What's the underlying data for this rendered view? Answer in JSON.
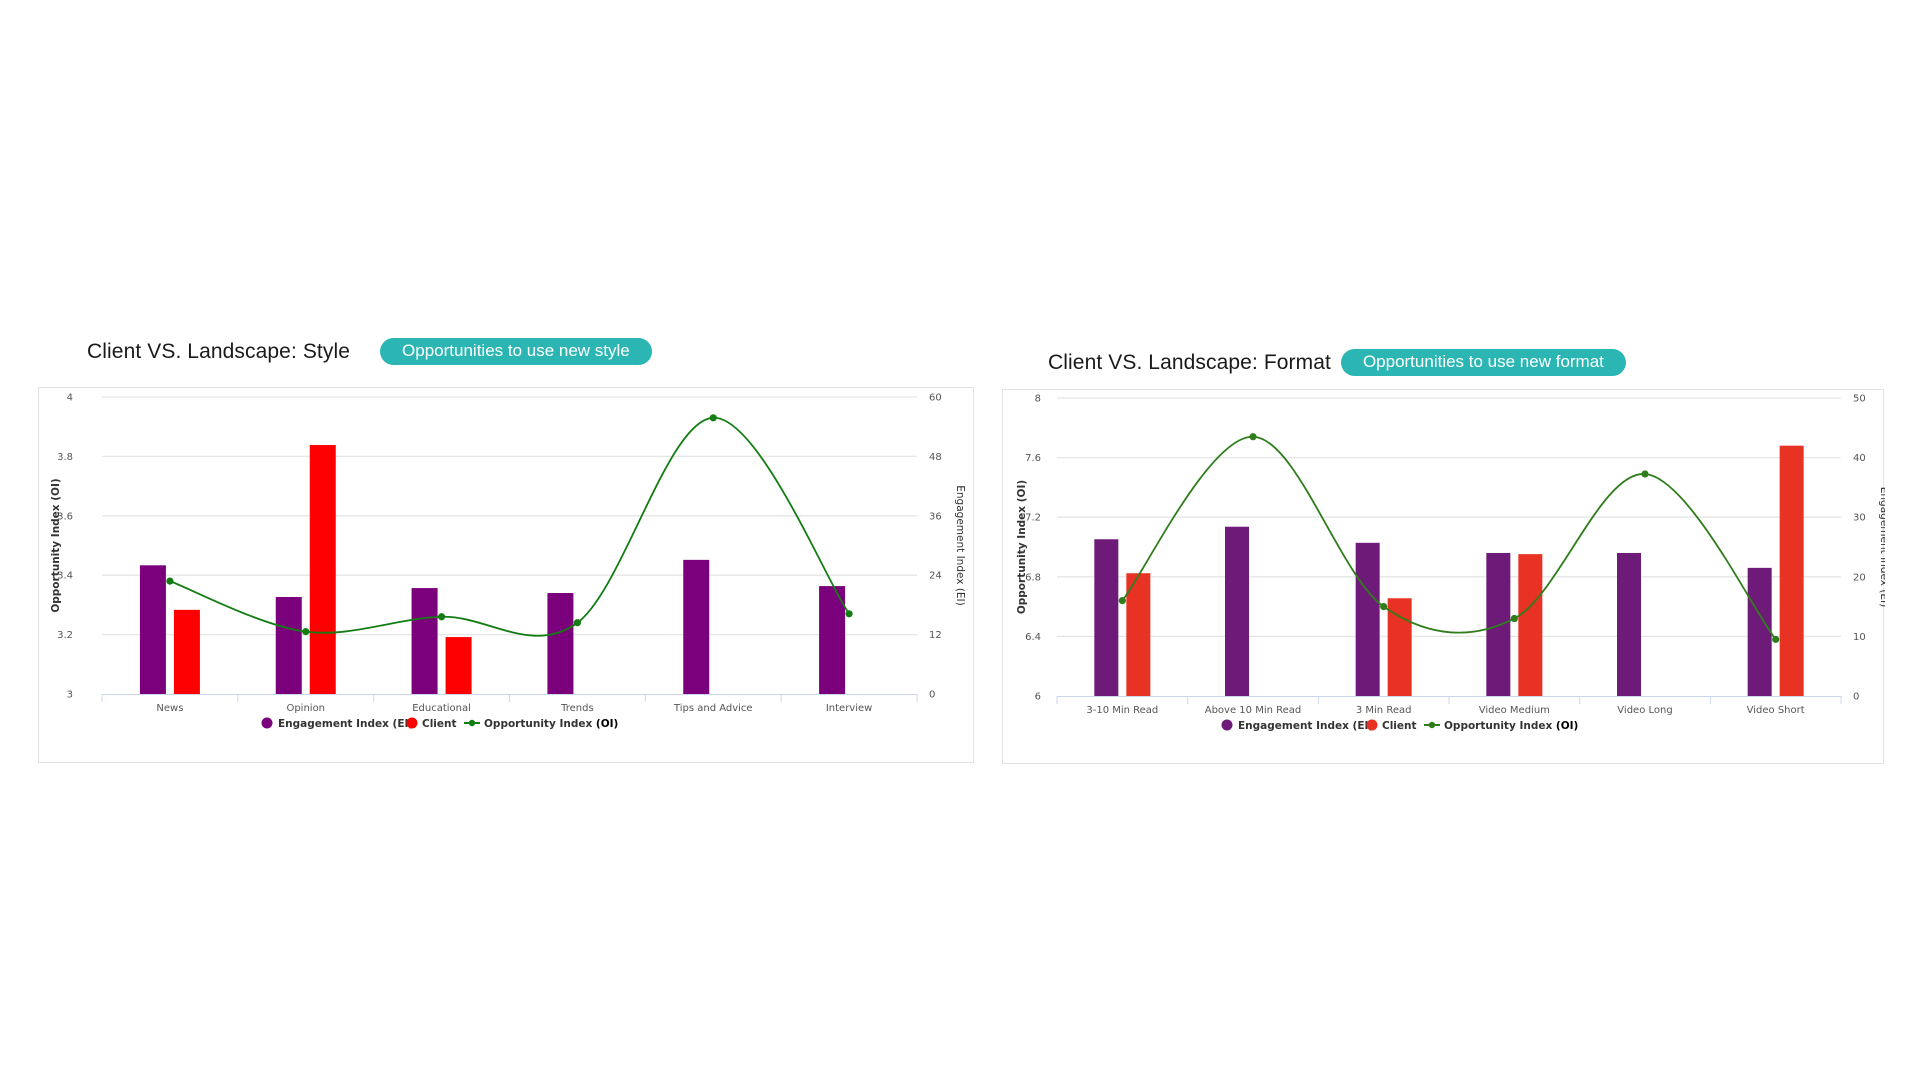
{
  "chart_data": [
    {
      "id": "style",
      "type": "bar",
      "title": "Client VS. Landscape: Style",
      "badge": "Opportunities to use new style",
      "categories": [
        "News",
        "Opinion",
        "Educational",
        "Trends",
        "Tips and Advice",
        "Interview"
      ],
      "series": [
        {
          "name": "Engagement Index (EI)",
          "type": "bar",
          "axis": "right",
          "color": "#7b007b",
          "values": [
            26,
            19.6,
            21.4,
            20.4,
            27.1,
            21.8
          ]
        },
        {
          "name": "Client",
          "type": "bar",
          "axis": "right",
          "color": "#ff0000",
          "values": [
            17,
            50.3,
            11.5,
            null,
            null,
            null
          ]
        },
        {
          "name": "Opportunity Index",
          "type": "line",
          "smooth": true,
          "axis": "left",
          "color": "#137d13",
          "values": [
            3.38,
            3.21,
            3.26,
            3.24,
            3.93,
            3.27
          ]
        }
      ],
      "ylabel": "Opportunity Index (OI)",
      "y2label": "Engagement Index (EI)",
      "ylim": [
        3,
        4
      ],
      "yticks": [
        "3",
        "3.2",
        "3.4",
        "3.6",
        "3.8",
        "4"
      ],
      "y2lim": [
        0,
        60
      ],
      "y2ticks": [
        "0",
        "12",
        "24",
        "36",
        "48",
        "60"
      ],
      "grid": true,
      "legend": {
        "placement": "bottom-center",
        "items": [
          {
            "label": "Engagement Index (EI)",
            "bold_suffix": ""
          },
          {
            "label": "Client",
            "bold_suffix": ""
          },
          {
            "label": "Opportunity Index ",
            "bold_suffix": "(OI)"
          }
        ]
      }
    },
    {
      "id": "format",
      "type": "bar",
      "title": "Client VS. Landscape: Format",
      "badge": "Opportunities to use new format",
      "categories": [
        "3-10 Min Read",
        "Above 10 Min Read",
        "3 Min Read",
        "Video Medium",
        "Video Long",
        "Video Short"
      ],
      "series": [
        {
          "name": "Engagement Index (EI)",
          "type": "bar",
          "axis": "right",
          "color": "#6e1a78",
          "values": [
            26.3,
            28.4,
            25.7,
            24.0,
            24.0,
            21.5
          ]
        },
        {
          "name": "Client",
          "type": "bar",
          "axis": "right",
          "color": "#e83224",
          "values": [
            20.6,
            null,
            16.4,
            23.8,
            null,
            42.0
          ]
        },
        {
          "name": "Opportunity Index",
          "type": "line",
          "smooth": true,
          "axis": "left",
          "color": "#2f7d1b",
          "values": [
            6.64,
            7.74,
            6.6,
            6.52,
            7.49,
            6.38
          ]
        }
      ],
      "ylabel": "Opportunity Index (OI)",
      "y2label": "Engagement Index (EI)",
      "ylim": [
        6,
        8
      ],
      "yticks": [
        "6",
        "6.4",
        "6.8",
        "7.2",
        "7.6",
        "8"
      ],
      "y2lim": [
        0,
        50
      ],
      "y2ticks": [
        "0",
        "10",
        "20",
        "30",
        "40",
        "50"
      ],
      "grid": true,
      "legend": {
        "placement": "bottom-center",
        "items": [
          {
            "label": "Engagement Index (EI)",
            "bold_suffix": ""
          },
          {
            "label": "Client",
            "bold_suffix": ""
          },
          {
            "label": "Opportunity Index ",
            "bold_suffix": "(OI)"
          }
        ]
      }
    }
  ]
}
